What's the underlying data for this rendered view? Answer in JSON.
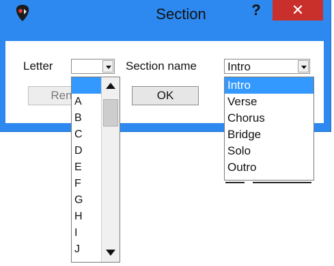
{
  "window": {
    "title": "Section",
    "help_label": "?",
    "close_label": "✕"
  },
  "form": {
    "letter_label": "Letter",
    "letter_value": "",
    "section_label": "Section name",
    "section_value": "Intro",
    "rename_label": "Ren",
    "ok_label": "OK"
  },
  "letter_dropdown": {
    "items": [
      "",
      "A",
      "B",
      "C",
      "D",
      "E",
      "F",
      "G",
      "H",
      "I",
      "J"
    ],
    "selected_index": 0
  },
  "section_dropdown": {
    "items": [
      "Intro",
      "Verse",
      "Chorus",
      "Bridge",
      "Solo",
      "Outro"
    ],
    "selected_index": 0
  },
  "colors": {
    "titlebar": "#2d89ef",
    "close": "#c9302c",
    "selection": "#3399ff"
  },
  "icons": {
    "app": "guitar-pick-icon",
    "combo_arrow": "chevron-down-icon",
    "scroll_up": "arrow-up-icon",
    "scroll_down": "arrow-down-icon"
  }
}
